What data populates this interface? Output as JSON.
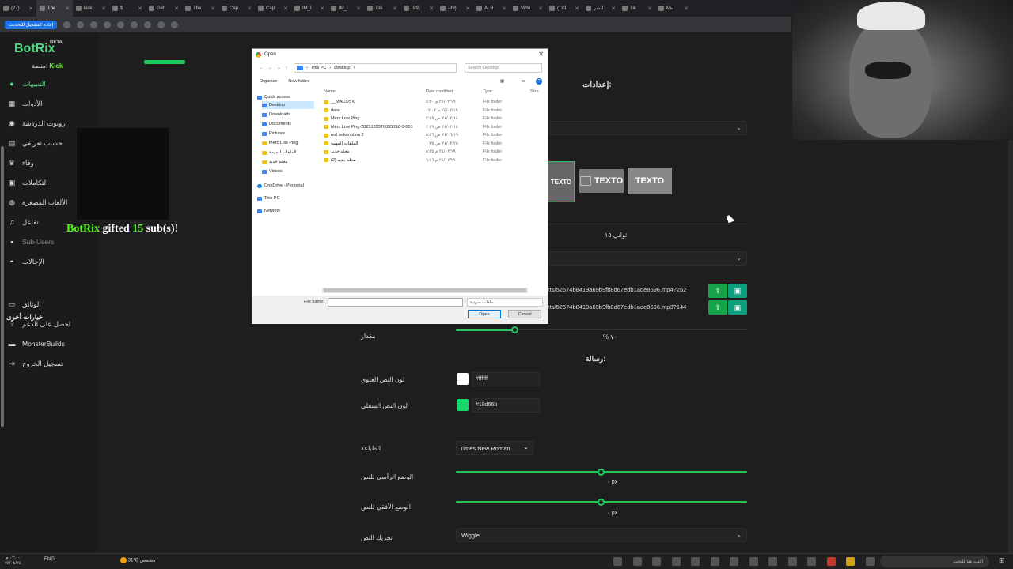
{
  "browser": {
    "tabs": [
      "(27)",
      "The",
      "kick",
      "$",
      "Get",
      "The",
      "Cap",
      "Cap",
      "IM_I",
      "IM_I",
      "‏Tok",
      "-99)",
      "-99)",
      "ALB",
      "Virtu",
      "(181",
      "لبشر",
      "Tik",
      "Мы"
    ],
    "active_tab": 1,
    "reload_label": "إعادة التشغيل للتحديث"
  },
  "sidebar": {
    "brand": "BotRix",
    "beta": "BETA",
    "platform_label": "منصة:",
    "platform_value": "Kick",
    "items": [
      {
        "label": "التنبيهات",
        "icon": "alert-icon"
      },
      {
        "label": "الأدوات",
        "icon": "tools-icon"
      },
      {
        "label": "روبوت الدردشة",
        "icon": "bot-icon"
      },
      {
        "label": "حساب تعريفي",
        "icon": "profile-icon"
      },
      {
        "label": "وفاء",
        "icon": "trophy-icon"
      },
      {
        "label": "التكاملات",
        "icon": "integrations-icon"
      },
      {
        "label": "الألعاب المصغرة",
        "icon": "gamepad-icon"
      },
      {
        "label": "تفاعل",
        "icon": "music-icon"
      },
      {
        "label": "Sub-Users",
        "icon": "lock-icon"
      },
      {
        "label": "الإحالات",
        "icon": "users-icon"
      }
    ],
    "other_options": "خيارات أخرى",
    "other_items": [
      {
        "label": "الوثائق",
        "icon": "docs-icon"
      },
      {
        "label": "احصل على الدعم",
        "icon": "help-icon"
      },
      {
        "label": "MonsterBuilds",
        "icon": "monitor-icon"
      },
      {
        "label": "تسجيل الخروج",
        "icon": "logout-icon"
      }
    ]
  },
  "alert_preview": {
    "name": "BotRix",
    "text1": "gifted",
    "count": "15",
    "text2": "sub(s)!"
  },
  "settings": {
    "heading": "إعدادات:",
    "duration": "ثواني ١٥",
    "video_url": "erts/52674b8419a69b9fb8d67edb1ade8696.mp4?252",
    "audio_url": "erts/52674b8419a69b9fb8d67edb1ade8696.mp3?144",
    "volume_label": "مقدار",
    "volume_value": "% ٧٠",
    "volume": 0.2,
    "message_heading": "رسالة:",
    "top_color_label": "لون النص العلوي",
    "top_color": "#ffffff",
    "bottom_color_label": "لون النص السفلي",
    "bottom_color": "#19d66b",
    "font_label": "الطباعة",
    "font_value": "Times New Roman",
    "vpos_label": "الوضع الرأسي للنص",
    "vpos_value": "٠ px",
    "hpos_label": "الوضع الأفقي للنص",
    "hpos_value": "٠ px",
    "animation_label": "تحريك النص",
    "animation_value": "Wiggle",
    "layout_preview_text": "TEXTO"
  },
  "dialog": {
    "title": "Open",
    "path": [
      "This PC",
      "Desktop"
    ],
    "search_placeholder": "Search Desktop",
    "organize": "Organize",
    "new_folder": "New folder",
    "nav": [
      {
        "label": "Quick access",
        "type": "blue"
      },
      {
        "label": "Desktop",
        "type": "blue",
        "selected": true
      },
      {
        "label": "Downloads",
        "type": "blue"
      },
      {
        "label": "Documents",
        "type": "blue"
      },
      {
        "label": "Pictures",
        "type": "blue"
      },
      {
        "label": "Merc Low Ping",
        "type": "folder"
      },
      {
        "label": "الملفات المهمة",
        "type": "folder"
      },
      {
        "label": "مجلد جديد",
        "type": "folder"
      },
      {
        "label": "Videos",
        "type": "blue"
      },
      {
        "label": "OneDrive - Personal",
        "type": "cloud"
      },
      {
        "label": "This PC",
        "type": "blue"
      },
      {
        "label": "Network",
        "type": "blue"
      }
    ],
    "columns": [
      "Name",
      "Date modified",
      "Type",
      "Size"
    ],
    "files": [
      {
        "name": "__MACOSX",
        "date": "٢٤/٠٢/١٩ م ٥:٢٠",
        "type": "File folder"
      },
      {
        "name": "data",
        "date": "٢٤/٠٢/١٩ م ٠٢:٠٢",
        "type": "File folder"
      },
      {
        "name": "Merc Low Ping",
        "date": "٢٤/٠٢/١٤ ص ٢:٥٩",
        "type": "File folder"
      },
      {
        "name": "Merc Low Ping-20251205T005505Z-3-001",
        "date": "٢٤/٠٢/١٤ ص ٢:٥٩",
        "type": "File folder"
      },
      {
        "name": "red redemption 2",
        "date": "٢٤/٠٦/١٩ ص ٥:٥٦",
        "type": "File folder"
      },
      {
        "name": "الملفات المهمة",
        "date": "٢٤/٠٢/٢٥ ص ٠:٣٥",
        "type": "File folder"
      },
      {
        "name": "مجلد جديد",
        "date": "٢٤/٠٢/١٩ م ٥:٢٥",
        "type": "File folder"
      },
      {
        "name": "مجلد جديد (2)",
        "date": "٢٤/٠٧/٢٩ م ٩:٥٦",
        "type": "File folder"
      }
    ],
    "file_name_label": "File name:",
    "file_type": "ملفات صوتية",
    "open_label": "Open",
    "cancel_label": "Cancel"
  },
  "taskbar": {
    "lang": "ENG",
    "weather": "31°C  مشمس",
    "time": "٠٢:٠٠ م",
    "date": "٢٥/٠٨/٢٤",
    "search_placeholder": "اكتب هنا للبحث"
  }
}
